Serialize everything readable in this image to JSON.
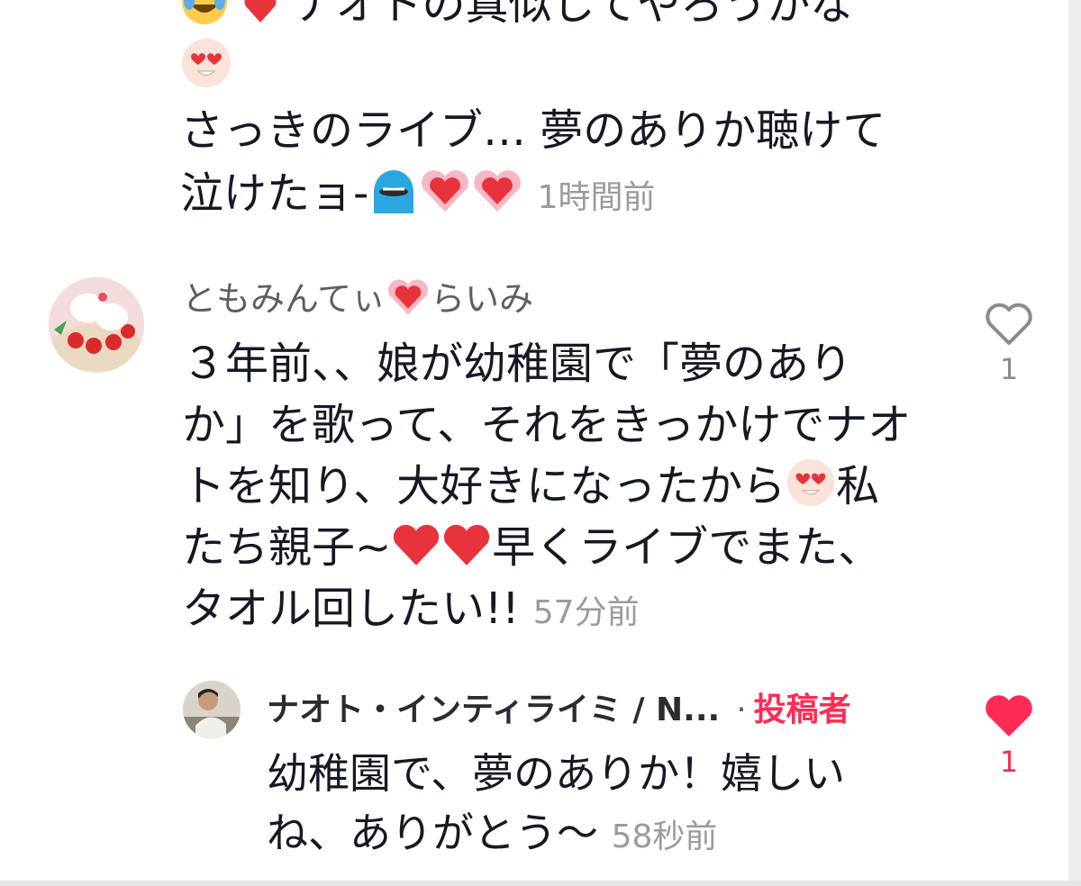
{
  "prev_comment": {
    "clipped_line": "ナオトの真似してやろうかな",
    "lines": [
      "さっきのライブ… 夢のありか聴けて",
      "泣けたョ-"
    ],
    "timestamp": "1時間前"
  },
  "comment": {
    "username_part1": "ともみんてぃ",
    "username_part2": "らいみ",
    "lines": [
      "３年前、、娘が幼稚園で「夢のあり",
      "か」を歌って、それをきっかけでナオ",
      "トを知り、大好きになったから",
      "私",
      "たち親子~",
      "早くライブでまた、",
      "タオル回したい!!"
    ],
    "timestamp": "57分前",
    "like_count": "1",
    "like_icon": "heart-outline-icon"
  },
  "reply": {
    "username": "ナオト・インティライミ / N...",
    "separator": "·",
    "badge": "投稿者",
    "lines": [
      "幼稚園で、夢のありか！嬉しい",
      "ね、ありがとう〜"
    ],
    "timestamp": "58秒前",
    "like_count": "1",
    "like_icon": "heart-filled-icon"
  },
  "colors": {
    "accent": "#fe2c55",
    "username": "#5d5e66",
    "timestamp": "#9a9aa0",
    "text": "#161823",
    "heart_emoji": "#e8323c"
  }
}
